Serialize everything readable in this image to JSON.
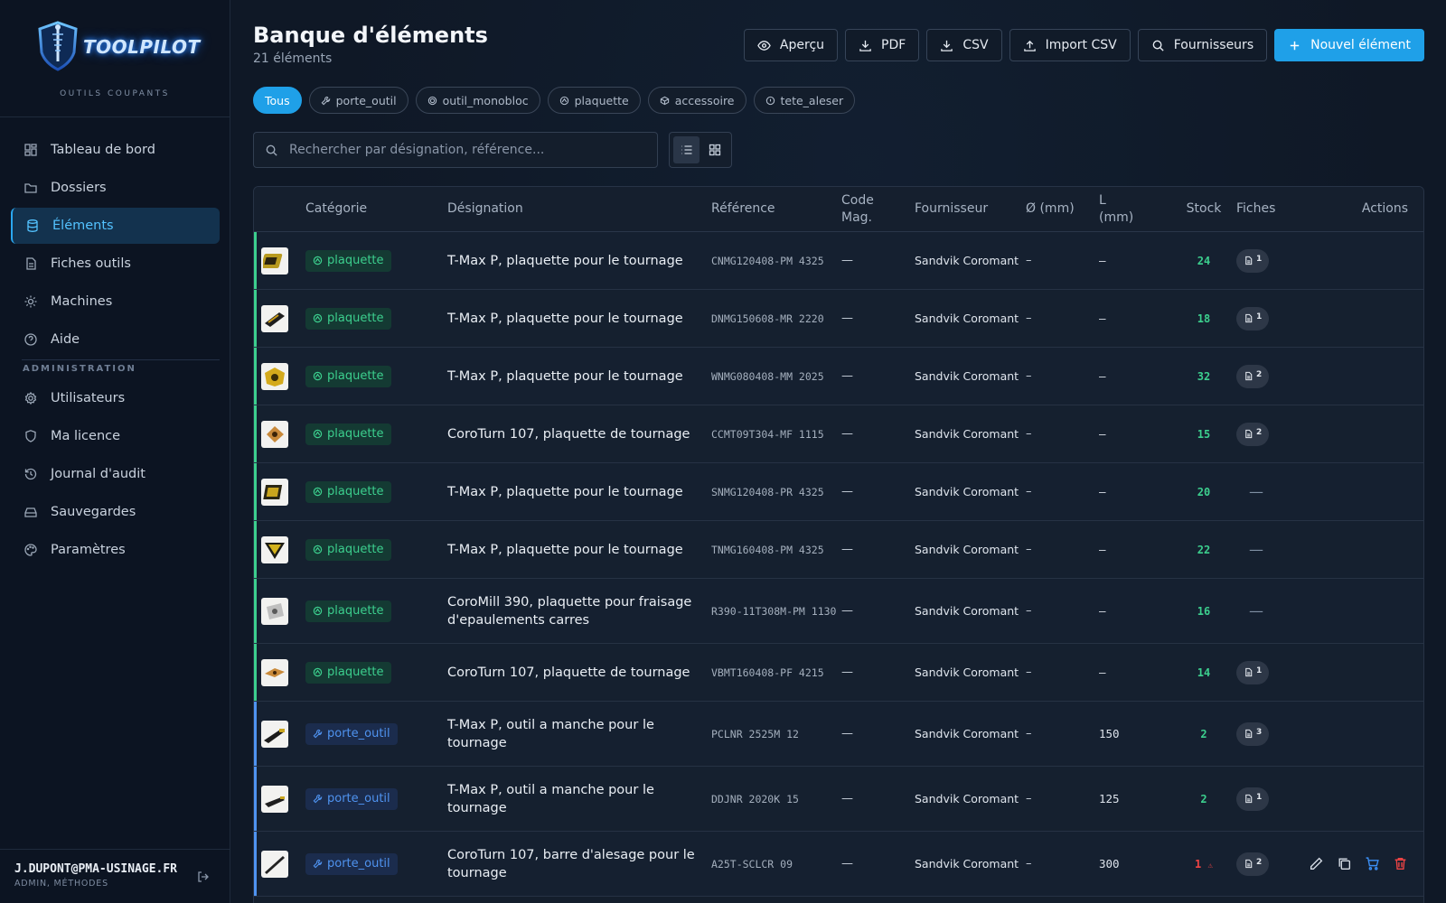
{
  "sidebar": {
    "logo_text": "TOOLPILOT",
    "logo_subtitle": "OUTILS COUPANTS",
    "nav": [
      {
        "label": "Tableau de bord",
        "icon": "dashboard-icon",
        "active": false
      },
      {
        "label": "Dossiers",
        "icon": "folder-icon",
        "active": false
      },
      {
        "label": "Éléments",
        "icon": "database-icon",
        "active": true
      },
      {
        "label": "Fiches outils",
        "icon": "document-icon",
        "active": false
      },
      {
        "label": "Machines",
        "icon": "cog-icon",
        "active": false
      },
      {
        "label": "Aide",
        "icon": "help-icon",
        "active": false
      }
    ],
    "admin_section": "ADMINISTRATION",
    "admin_nav": [
      {
        "label": "Utilisateurs",
        "icon": "settings-icon"
      },
      {
        "label": "Ma licence",
        "icon": "shield-icon"
      },
      {
        "label": "Journal d'audit",
        "icon": "history-icon"
      },
      {
        "label": "Sauvegardes",
        "icon": "drive-icon"
      },
      {
        "label": "Paramètres",
        "icon": "palette-icon"
      }
    ],
    "user": {
      "email": "J.DUPONT@PMA-USINAGE.FR",
      "role": "ADMIN, MÉTHODES"
    }
  },
  "header": {
    "title": "Banque d'éléments",
    "count": "21 éléments",
    "buttons": {
      "apercu": "Aperçu",
      "pdf": "PDF",
      "csv": "CSV",
      "import_csv": "Import CSV",
      "fournisseurs": "Fournisseurs",
      "nouvel": "Nouvel élément"
    }
  },
  "filters": [
    "Tous",
    "porte_outil",
    "outil_monobloc",
    "plaquette",
    "accessoire",
    "tete_aleser"
  ],
  "search": {
    "placeholder": "Rechercher par désignation, référence..."
  },
  "table": {
    "headers": {
      "categorie": "Catégorie",
      "designation": "Désignation",
      "reference": "Référence",
      "code_mag": "Code Mag.",
      "fournisseur": "Fournisseur",
      "diametre": "Ø (mm)",
      "longueur": "L (mm)",
      "stock": "Stock",
      "fiches": "Fiches",
      "actions": "Actions"
    },
    "rows": [
      {
        "cat": "plaquette",
        "des": "T-Max P, plaquette pour le tournage",
        "ref": "CNMG120408-PM 4325",
        "code": "—",
        "four": "Sandvik Coromant",
        "d": "–",
        "l": "–",
        "stock": "24",
        "fiches": "1",
        "thumb": "cnmg"
      },
      {
        "cat": "plaquette",
        "des": "T-Max P, plaquette pour le tournage",
        "ref": "DNMG150608-MR 2220",
        "code": "—",
        "four": "Sandvik Coromant",
        "d": "–",
        "l": "–",
        "stock": "18",
        "fiches": "1",
        "thumb": "dnmg"
      },
      {
        "cat": "plaquette",
        "des": "T-Max P, plaquette pour le tournage",
        "ref": "WNMG080408-MM 2025",
        "code": "—",
        "four": "Sandvik Coromant",
        "d": "–",
        "l": "–",
        "stock": "32",
        "fiches": "2",
        "thumb": "wnmg"
      },
      {
        "cat": "plaquette",
        "des": "CoroTurn 107, plaquette de tournage",
        "ref": "CCMT09T304-MF 1115",
        "code": "—",
        "four": "Sandvik Coromant",
        "d": "–",
        "l": "–",
        "stock": "15",
        "fiches": "2",
        "thumb": "ccmt"
      },
      {
        "cat": "plaquette",
        "des": "T-Max P, plaquette pour le tournage",
        "ref": "SNMG120408-PR 4325",
        "code": "—",
        "four": "Sandvik Coromant",
        "d": "–",
        "l": "–",
        "stock": "20",
        "fiches": "",
        "thumb": "snmg"
      },
      {
        "cat": "plaquette",
        "des": "T-Max P, plaquette pour le tournage",
        "ref": "TNMG160408-PM 4325",
        "code": "—",
        "four": "Sandvik Coromant",
        "d": "–",
        "l": "–",
        "stock": "22",
        "fiches": "",
        "thumb": "tnmg"
      },
      {
        "cat": "plaquette",
        "des": "CoroMill 390, plaquette pour fraisage d'epaulements carres",
        "ref": "R390-11T308M-PM 1130",
        "code": "—",
        "four": "Sandvik Coromant",
        "d": "–",
        "l": "–",
        "stock": "16",
        "fiches": "",
        "thumb": "r390"
      },
      {
        "cat": "plaquette",
        "des": "CoroTurn 107, plaquette de tournage",
        "ref": "VBMT160408-PF 4215",
        "code": "—",
        "four": "Sandvik Coromant",
        "d": "–",
        "l": "–",
        "stock": "14",
        "fiches": "1",
        "thumb": "vbmt"
      },
      {
        "cat": "porte_outil",
        "des": "T-Max P, outil a manche pour le tournage",
        "ref": "PCLNR 2525M 12",
        "code": "—",
        "four": "Sandvik Coromant",
        "d": "–",
        "l": "150",
        "stock": "2",
        "fiches": "3",
        "thumb": "holder"
      },
      {
        "cat": "porte_outil",
        "des": "T-Max P, outil a manche pour le tournage",
        "ref": "DDJNR 2020K 15",
        "code": "—",
        "four": "Sandvik Coromant",
        "d": "–",
        "l": "125",
        "stock": "2",
        "fiches": "1",
        "thumb": "holder2"
      },
      {
        "cat": "porte_outil",
        "des": "CoroTurn 107, barre d'alesage pour le tournage",
        "ref": "A25T-SCLCR 09",
        "code": "—",
        "four": "Sandvik Coromant",
        "d": "–",
        "l": "300",
        "stock": "1",
        "stock_warn": "⚠",
        "fiches": "2",
        "thumb": "bar"
      }
    ],
    "empty_fiche": "—"
  },
  "colors": {
    "accent": "#1fa0e8",
    "plaquette": "#3ccf8e",
    "porte_outil": "#4f93f0",
    "stock_ok": "#3ccf8e",
    "stock_low": "#ef4444"
  }
}
